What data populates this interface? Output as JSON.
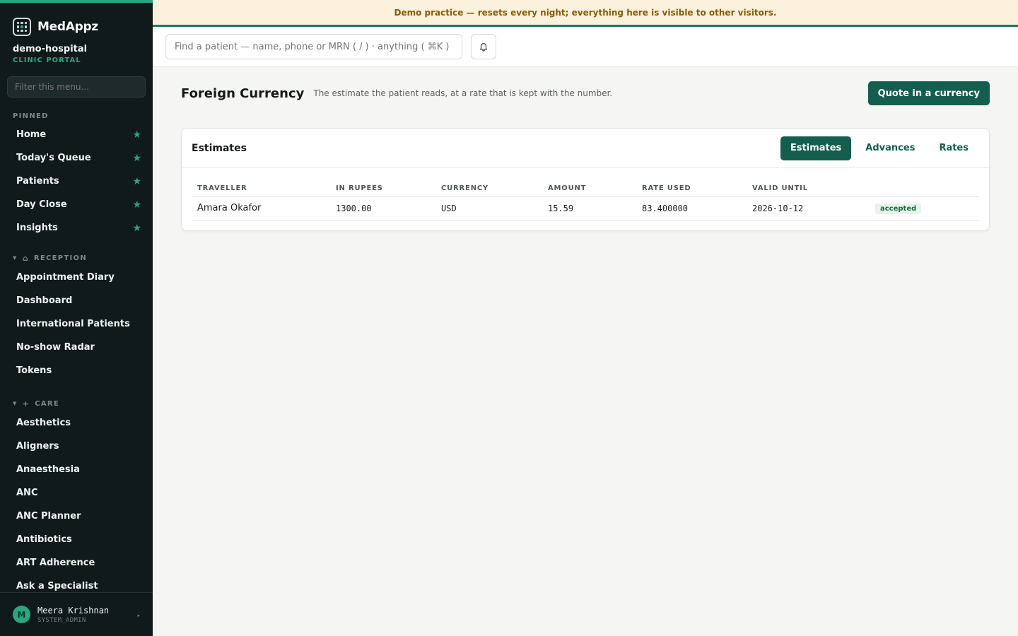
{
  "app": {
    "name": "MedAppz",
    "org_name": "demo-hospital",
    "org_subtitle": "CLINIC PORTAL"
  },
  "banner": {
    "text": "Demo practice — resets every night; everything here is visible to other visitors."
  },
  "sidebar": {
    "filter_placeholder": "Filter this menu...",
    "pinned_label": "PINNED",
    "pinned": [
      {
        "label": "Home"
      },
      {
        "label": "Today's Queue"
      },
      {
        "label": "Patients"
      },
      {
        "label": "Day Close"
      },
      {
        "label": "Insights"
      }
    ],
    "reception_label": "RECEPTION",
    "reception": [
      {
        "label": "Appointment Diary"
      },
      {
        "label": "Dashboard"
      },
      {
        "label": "International Patients"
      },
      {
        "label": "No-show Radar"
      },
      {
        "label": "Tokens"
      }
    ],
    "care_label": "CARE",
    "care": [
      {
        "label": "Aesthetics"
      },
      {
        "label": "Aligners"
      },
      {
        "label": "Anaesthesia"
      },
      {
        "label": "ANC"
      },
      {
        "label": "ANC Planner"
      },
      {
        "label": "Antibiotics"
      },
      {
        "label": "ART Adherence"
      },
      {
        "label": "Ask a Specialist"
      }
    ],
    "user": {
      "initial": "M",
      "name": "Meera Krishnan",
      "role": "SYSTEM_ADMIN"
    }
  },
  "topbar": {
    "search_placeholder": "Find a patient — name, phone or MRN ( / ) · anything ( ⌘K )"
  },
  "page": {
    "title": "Foreign Currency",
    "description": "The estimate the patient reads, at a rate that is kept with the number.",
    "primary_action": "Quote in a currency"
  },
  "card": {
    "title": "Estimates",
    "tabs": [
      {
        "label": "Estimates",
        "active": true
      },
      {
        "label": "Advances",
        "active": false
      },
      {
        "label": "Rates",
        "active": false
      }
    ],
    "columns": [
      "TRAVELLER",
      "IN RUPEES",
      "CURRENCY",
      "AMOUNT",
      "RATE USED",
      "VALID UNTIL",
      ""
    ],
    "rows": [
      {
        "traveller": "Amara Okafor",
        "in_rupees": "1300.00",
        "currency": "USD",
        "amount": "15.59",
        "rate_used": "83.400000",
        "valid_until": "2026-10-12",
        "status": "accepted"
      }
    ]
  },
  "colors": {
    "accent": "#2aa582",
    "primary": "#145e4d",
    "sidebar_bg": "#111a1b",
    "banner_bg": "#fbf1dc",
    "banner_text": "#8a5a05"
  }
}
